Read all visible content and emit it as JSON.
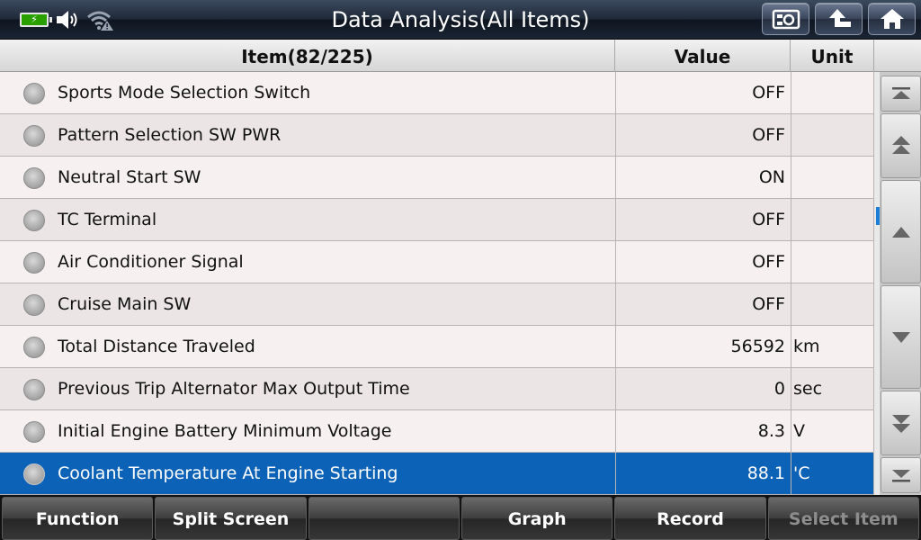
{
  "header": {
    "title": "Data Analysis(All Items)",
    "status": {
      "battery_icon": "battery-charging-icon",
      "volume_icon": "speaker-icon",
      "wifi_icon": "wifi-warning-icon"
    },
    "buttons": [
      {
        "name": "screenshot-button",
        "icon": "camera-icon"
      },
      {
        "name": "back-button",
        "icon": "back-arrow-icon"
      },
      {
        "name": "home-button",
        "icon": "home-icon"
      }
    ]
  },
  "table": {
    "headers": {
      "item": "Item(82/225)",
      "value": "Value",
      "unit": "Unit"
    },
    "rows": [
      {
        "item": "Sports Mode Selection Switch",
        "value": "OFF",
        "unit": ""
      },
      {
        "item": "Pattern Selection SW PWR",
        "value": "OFF",
        "unit": ""
      },
      {
        "item": "Neutral Start SW",
        "value": "ON",
        "unit": ""
      },
      {
        "item": "TC Terminal",
        "value": "OFF",
        "unit": ""
      },
      {
        "item": "Air Conditioner Signal",
        "value": "OFF",
        "unit": ""
      },
      {
        "item": "Cruise Main SW",
        "value": "OFF",
        "unit": ""
      },
      {
        "item": "Total Distance Traveled",
        "value": "56592",
        "unit": "km"
      },
      {
        "item": "Previous Trip Alternator Max Output Time",
        "value": "0",
        "unit": "sec"
      },
      {
        "item": "Initial Engine Battery Minimum Voltage",
        "value": "8.3",
        "unit": "V"
      },
      {
        "item": "Coolant Temperature At Engine Starting",
        "value": "88.1",
        "unit": "'C",
        "selected": true
      }
    ]
  },
  "scroll": {
    "buttons": [
      "scroll-top-icon",
      "page-up-icon",
      "line-up-icon",
      "line-down-icon",
      "page-down-icon",
      "scroll-bottom-icon"
    ]
  },
  "toolbar": {
    "function": "Function",
    "split_screen": "Split Screen",
    "empty": "",
    "graph": "Graph",
    "record": "Record",
    "select_item": "Select Item"
  },
  "colors": {
    "selected_row": "#0c62b7",
    "scroll_thumb": "#1c7ed6",
    "battery": "#2aa000"
  }
}
